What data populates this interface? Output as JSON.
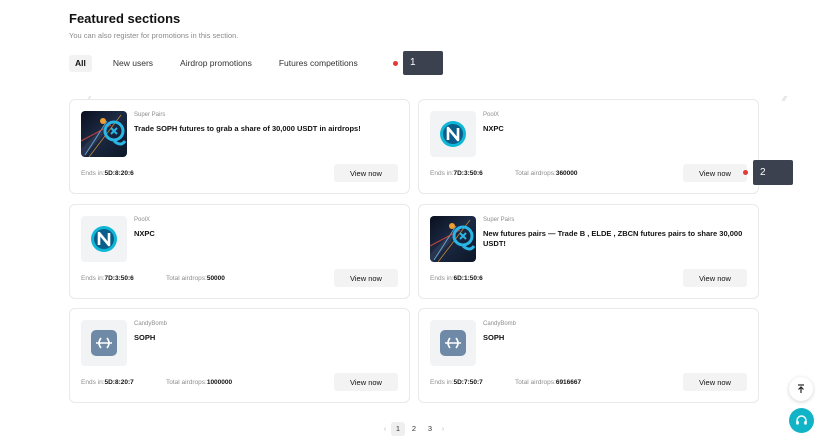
{
  "header": {
    "title": "Featured sections",
    "subtitle": "You can also register for promotions in this section."
  },
  "tabs": [
    {
      "label": "All",
      "active": true
    },
    {
      "label": "New users",
      "active": false
    },
    {
      "label": "Airdrop promotions",
      "active": false
    },
    {
      "label": "Futures competitions",
      "active": false
    }
  ],
  "markers": [
    {
      "label": "1"
    },
    {
      "label": "2"
    }
  ],
  "cards": [
    {
      "category": "Super Pairs",
      "title": "Trade SOPH futures to grab a share of 30,000 USDT in airdrops!",
      "ends_label": "Ends in:",
      "ends_value": "5D:8:20:6",
      "total_label": "",
      "total_value": "",
      "button": "View now",
      "icon": "super-pairs-banner-icon"
    },
    {
      "category": "PoolX",
      "title": "NXPC",
      "ends_label": "Ends in:",
      "ends_value": "7D:3:50:6",
      "total_label": "Total airdrops:",
      "total_value": "360000",
      "button": "View now",
      "icon": "nxpc-logo-icon"
    },
    {
      "category": "PoolX",
      "title": "NXPC",
      "ends_label": "Ends in:",
      "ends_value": "7D:3:50:6",
      "total_label": "Total airdrops:",
      "total_value": "50000",
      "button": "View now",
      "icon": "nxpc-logo-icon"
    },
    {
      "category": "Super Pairs",
      "title": "New futures pairs — Trade B , ELDE , ZBCN futures pairs to share 30,000 USDT!",
      "ends_label": "Ends in:",
      "ends_value": "6D:1:50:6",
      "total_label": "",
      "total_value": "",
      "button": "View now",
      "icon": "super-pairs-banner-icon"
    },
    {
      "category": "CandyBomb",
      "title": "SOPH",
      "ends_label": "Ends in:",
      "ends_value": "5D:8:20:7",
      "total_label": "Total airdrops:",
      "total_value": "1000000",
      "button": "View now",
      "icon": "soph-logo-icon"
    },
    {
      "category": "CandyBomb",
      "title": "SOPH",
      "ends_label": "Ends in:",
      "ends_value": "5D:7:50:7",
      "total_label": "Total airdrops:",
      "total_value": "6916667",
      "button": "View now",
      "icon": "soph-logo-icon"
    }
  ],
  "pagination": {
    "prev": "‹",
    "next": "›",
    "pages": [
      "1",
      "2",
      "3"
    ],
    "current": "1"
  },
  "colors": {
    "accent": "#11b4c6",
    "marker_dot": "#e53935",
    "marker_box": "#3c4150"
  }
}
